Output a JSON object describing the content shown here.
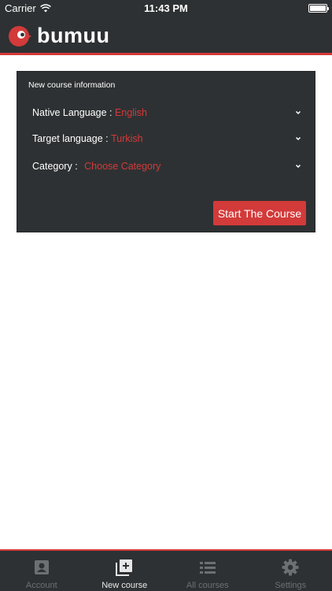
{
  "status_bar": {
    "carrier": "Carrier",
    "time": "11:43 PM",
    "icons": [
      "wifi-icon",
      "battery-icon"
    ]
  },
  "header": {
    "logo_text": "bumuu",
    "logo_icon": "bird-logo-icon"
  },
  "form": {
    "title": "New course information",
    "native_label": "Native Language : ",
    "native_value": "English",
    "target_label": "Target language : ",
    "target_value": "Turkish",
    "category_label": "Category : ",
    "category_value": "Choose Category",
    "start_label": "Start The Course"
  },
  "tabs": [
    {
      "label": "Account",
      "icon": "person-icon",
      "active": false
    },
    {
      "label": "New course",
      "icon": "add-icon",
      "active": true
    },
    {
      "label": "All courses",
      "icon": "list-icon",
      "active": false
    },
    {
      "label": "Settings",
      "icon": "gear-icon",
      "active": false
    }
  ],
  "colors": {
    "accent": "#d33a3a",
    "bar_bg": "#2e3133",
    "tab_inactive": "#6d7073",
    "tab_active": "#e6e6e6"
  }
}
